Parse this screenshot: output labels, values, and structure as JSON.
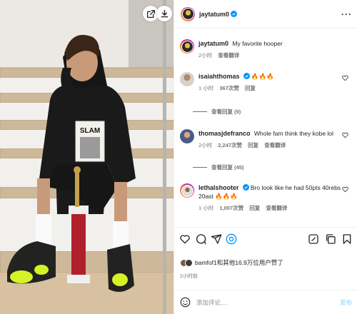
{
  "post": {
    "username": "jaytatum0",
    "menu_icon": "more-horizontal-icon"
  },
  "caption": {
    "username": "jaytatum0",
    "text": "My favorite hooper",
    "time": "2小时",
    "translate": "查看翻译"
  },
  "comments": [
    {
      "username": "isaiahthomas",
      "text": "🔥🔥🔥",
      "time": "1 小时",
      "likes": "367次赞",
      "reply": "回复",
      "view_replies": "查看回复 (9)"
    },
    {
      "username": "thomasjdefranco",
      "text": "Whole fam think they kobe lol",
      "time": "2小时",
      "likes": "2,247次赞",
      "reply": "回复",
      "translate": "查看翻译",
      "view_replies": "查看回复 (45)"
    },
    {
      "username": "lethalshooter",
      "text": "Bro look like he had 50pts 40rebs 20ast 🔥🔥🔥",
      "time": "1 小时",
      "likes": "1,007次赞",
      "reply": "回复",
      "translate": "查看翻译"
    }
  ],
  "photo": {
    "magazine_title": "SLAM"
  },
  "likes": {
    "text": "bamfof1和其他16.9万位用户赞了"
  },
  "time_ago": "2小时前",
  "composer": {
    "placeholder": "添加评论....",
    "post_label": "发布"
  },
  "colors": {
    "accent": "#0095f6",
    "verified": "#0095f6",
    "post_disabled": "#b2dffc",
    "muted": "#737373"
  }
}
